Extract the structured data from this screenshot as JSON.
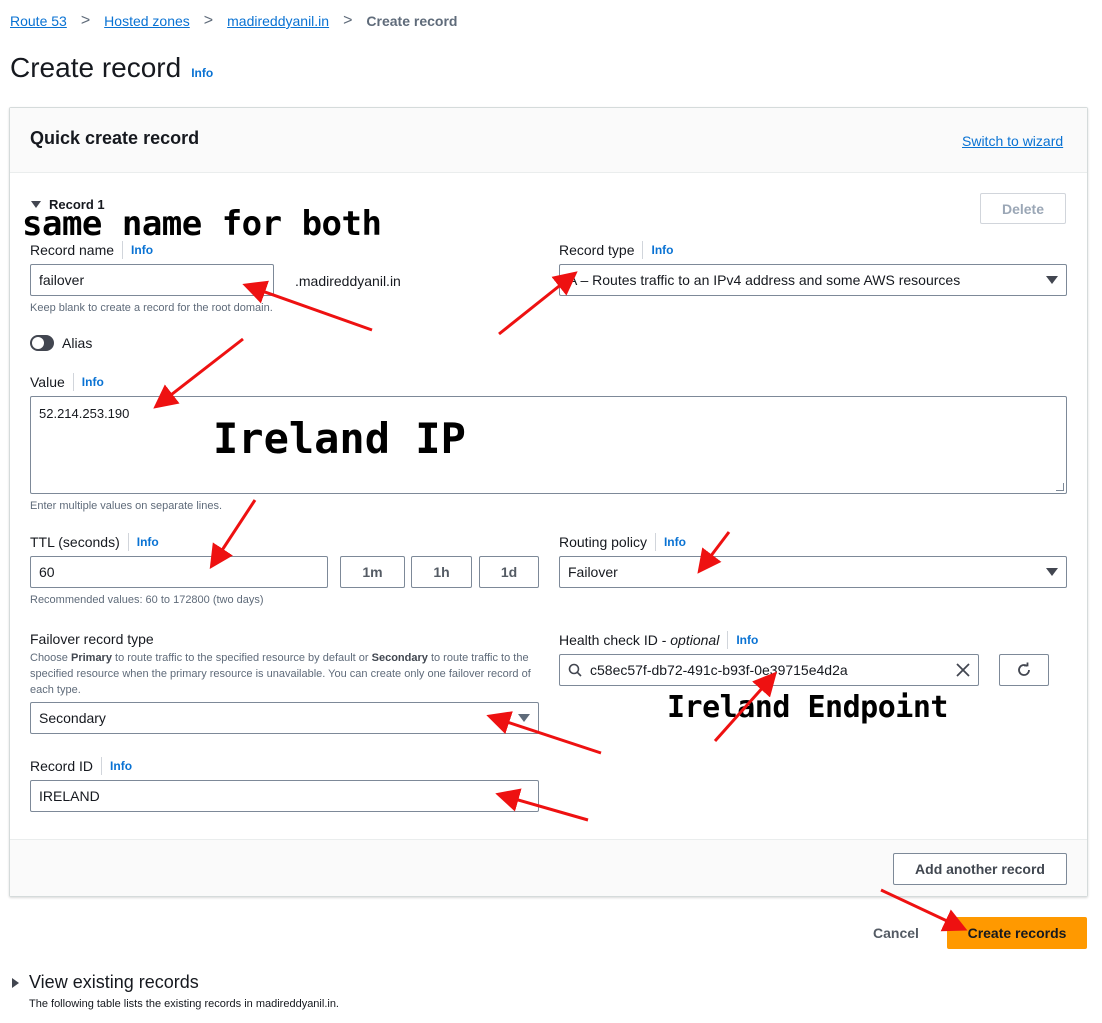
{
  "breadcrumb": {
    "items": [
      "Route 53",
      "Hosted zones",
      "madireddyanil.in"
    ],
    "current": "Create record",
    "separator": ">"
  },
  "page": {
    "title": "Create record",
    "info": "Info"
  },
  "panel": {
    "title": "Quick create record",
    "switch_link": "Switch to wizard"
  },
  "record": {
    "header": "Record 1",
    "delete_label": "Delete",
    "name": {
      "label": "Record name",
      "info": "Info",
      "value": "failover",
      "suffix": ".madireddyanil.in",
      "hint": "Keep blank to create a record for the root domain."
    },
    "type": {
      "label": "Record type",
      "info": "Info",
      "value": "A – Routes traffic to an IPv4 address and some AWS resources"
    },
    "alias": {
      "label": "Alias",
      "enabled": false
    },
    "value": {
      "label": "Value",
      "info": "Info",
      "value": "52.214.253.190",
      "hint": "Enter multiple values on separate lines."
    },
    "ttl": {
      "label": "TTL (seconds)",
      "info": "Info",
      "value": "60",
      "presets": [
        "1m",
        "1h",
        "1d"
      ],
      "hint": "Recommended values: 60 to 172800 (two days)"
    },
    "routing": {
      "label": "Routing policy",
      "info": "Info",
      "value": "Failover"
    },
    "failover_type": {
      "label": "Failover record type",
      "desc_1": "Choose ",
      "desc_primary": "Primary",
      "desc_2": " to route traffic to the specified resource by default or ",
      "desc_secondary": "Secondary",
      "desc_3": " to route traffic to the specified resource when the primary resource is unavailable. You can create only one failover record of each type.",
      "value": "Secondary"
    },
    "health_check": {
      "label": "Health check ID - ",
      "label_optional": "optional",
      "info": "Info",
      "value": "c58ec57f-db72-491c-b93f-0e39715e4d2a"
    },
    "record_id": {
      "label": "Record ID",
      "info": "Info",
      "value": "IRELAND"
    }
  },
  "actions": {
    "add_another": "Add another record",
    "cancel": "Cancel",
    "create": "Create records"
  },
  "existing": {
    "title": "View existing records",
    "desc": "The following table lists the existing records in madireddyanil.in."
  },
  "annotations": {
    "same_name": "same name for both",
    "ireland_ip": "Ireland IP",
    "ireland_endpoint": "Ireland Endpoint"
  },
  "colors": {
    "link": "#0972d3",
    "primary_button": "#ff9900",
    "annotation_arrow": "#ee1111"
  }
}
